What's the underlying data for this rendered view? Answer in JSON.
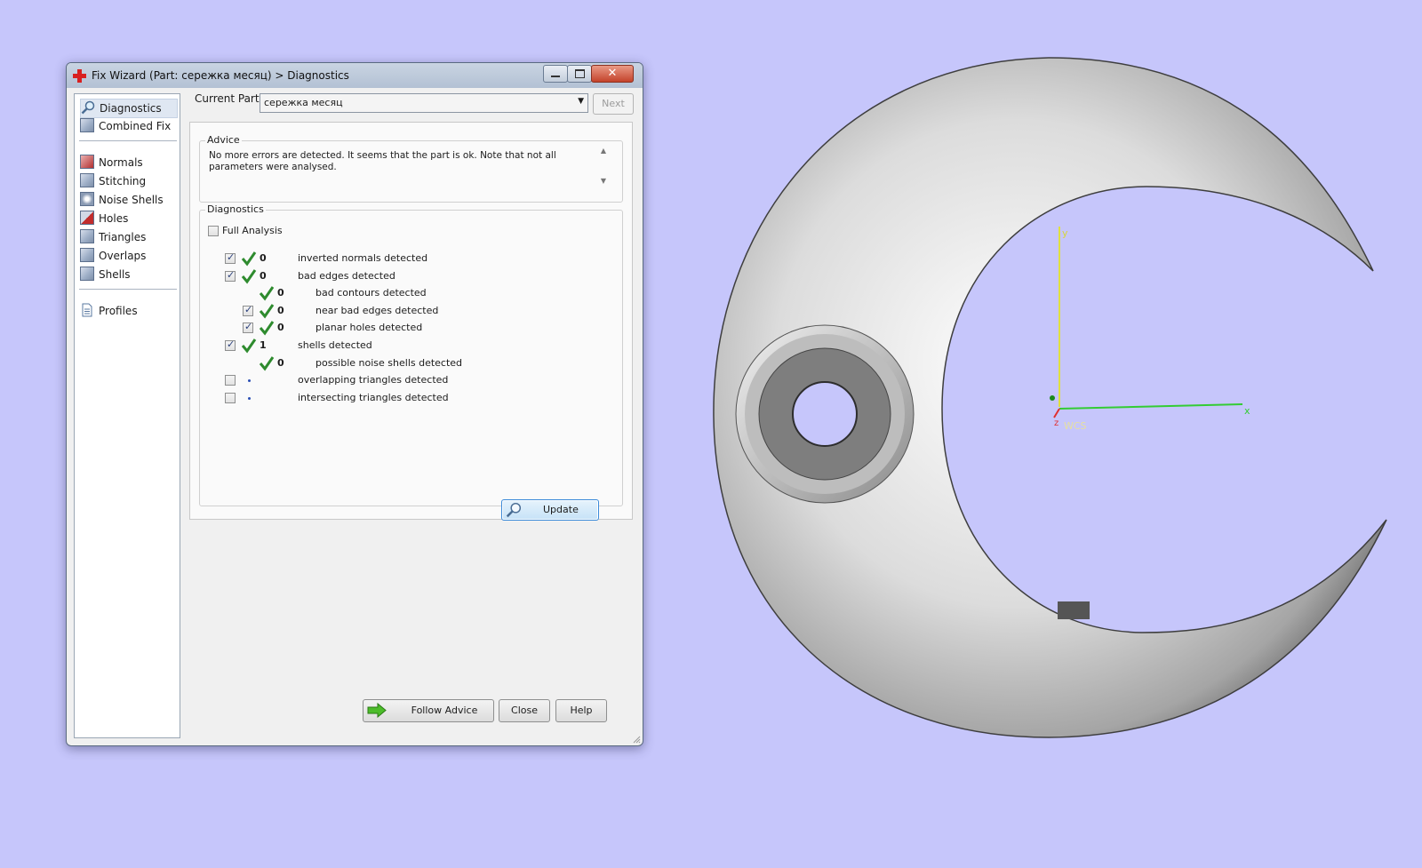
{
  "window": {
    "title": "Fix Wizard (Part: сережка месяц) > Diagnostics",
    "close_glyph": "✕"
  },
  "sidebar": {
    "items": [
      {
        "label": "Diagnostics",
        "icon": "magnifier-icon",
        "selected": true
      },
      {
        "label": "Combined Fix",
        "icon": "combined-fix-icon"
      },
      {
        "label": "Normals",
        "icon": "normals-icon"
      },
      {
        "label": "Stitching",
        "icon": "stitching-icon"
      },
      {
        "label": "Noise Shells",
        "icon": "noise-shells-icon"
      },
      {
        "label": "Holes",
        "icon": "holes-icon"
      },
      {
        "label": "Triangles",
        "icon": "triangles-icon"
      },
      {
        "label": "Overlaps",
        "icon": "overlaps-icon"
      },
      {
        "label": "Shells",
        "icon": "shells-icon"
      },
      {
        "label": "Profiles",
        "icon": "document-icon"
      }
    ]
  },
  "header": {
    "current_part_label": "Current Part:",
    "current_part_value": "сережка месяц",
    "next_label": "Next"
  },
  "advice": {
    "title": "Advice",
    "text": "No more errors are detected. It seems that the part is ok. Note that not all parameters were analysed."
  },
  "diagnostics": {
    "title": "Diagnostics",
    "full_analysis_label": "Full Analysis",
    "full_analysis_checked": false,
    "rows": [
      {
        "checked": true,
        "status": "ok",
        "count": "0",
        "label": "inverted normals detected",
        "indent": 0
      },
      {
        "checked": true,
        "status": "ok",
        "count": "0",
        "label": "bad edges detected",
        "indent": 0
      },
      {
        "checked": null,
        "status": "ok",
        "count": "0",
        "label": "bad contours detected",
        "indent": 1
      },
      {
        "checked": true,
        "status": "ok",
        "count": "0",
        "label": "near bad edges detected",
        "indent": 1
      },
      {
        "checked": true,
        "status": "ok",
        "count": "0",
        "label": "planar holes detected",
        "indent": 1
      },
      {
        "checked": true,
        "status": "ok",
        "count": "1",
        "label": "shells detected",
        "indent": 0
      },
      {
        "checked": null,
        "status": "ok",
        "count": "0",
        "label": "possible noise shells detected",
        "indent": 1
      },
      {
        "checked": false,
        "status": "pending",
        "count": "",
        "label": "overlapping triangles detected",
        "indent": 0
      },
      {
        "checked": false,
        "status": "pending",
        "count": "",
        "label": "intersecting triangles detected",
        "indent": 0
      }
    ],
    "update_label": "Update"
  },
  "footer": {
    "follow_advice_label": "Follow Advice",
    "close_label": "Close",
    "help_label": "Help"
  },
  "viewport": {
    "axis_y": "y",
    "axis_x": "x",
    "axis_z": "z",
    "wcs_label": "WCS"
  },
  "colors": {
    "background": "#c6c6fb",
    "check_green": "#2e8b2e",
    "axis_x": "#33cc33",
    "axis_y": "#e0e040",
    "axis_z": "#e03030"
  }
}
